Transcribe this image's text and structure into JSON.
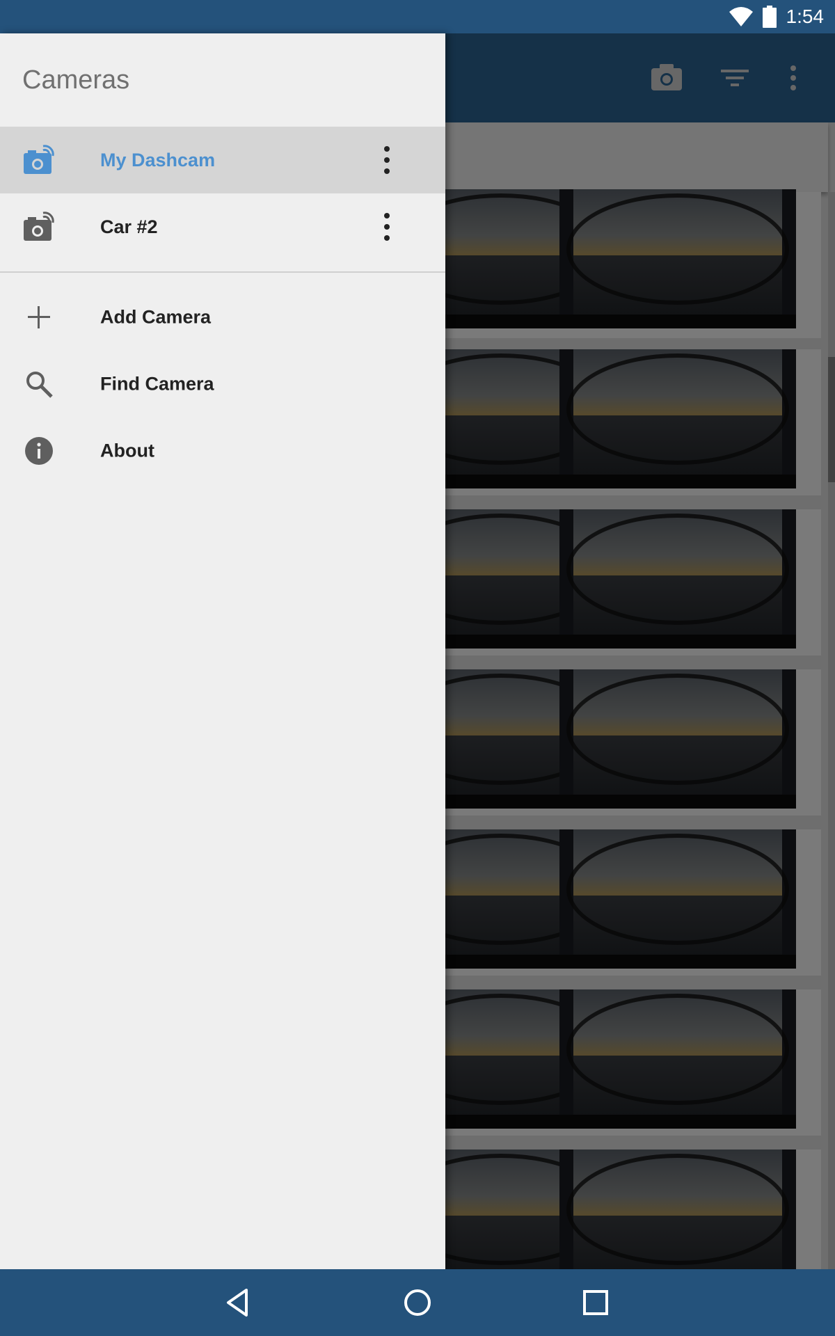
{
  "status_bar": {
    "time": "1:54",
    "icons": [
      "wifi-icon",
      "battery-icon"
    ]
  },
  "background_app": {
    "toolbar_icons": [
      "camera-icon",
      "filter-icon",
      "more-vert-icon"
    ],
    "thumbnails": 14
  },
  "drawer": {
    "title": "Cameras",
    "cameras": [
      {
        "label": "My Dashcam",
        "icon": "camera-wifi-icon",
        "selected": true
      },
      {
        "label": "Car #2",
        "icon": "camera-wifi-icon",
        "selected": false
      }
    ],
    "menu": [
      {
        "label": "Add Camera",
        "icon": "add-icon"
      },
      {
        "label": "Find Camera",
        "icon": "search-icon"
      },
      {
        "label": "About",
        "icon": "info-icon"
      }
    ]
  },
  "colors": {
    "status_bar": "#24527b",
    "toolbar": "#2c6697",
    "accent": "#4c90cf",
    "drawer_bg": "#efefef",
    "selected_bg": "#d5d5d5"
  },
  "nav_bar": {
    "buttons": [
      "back-icon",
      "home-icon",
      "recents-icon"
    ]
  }
}
